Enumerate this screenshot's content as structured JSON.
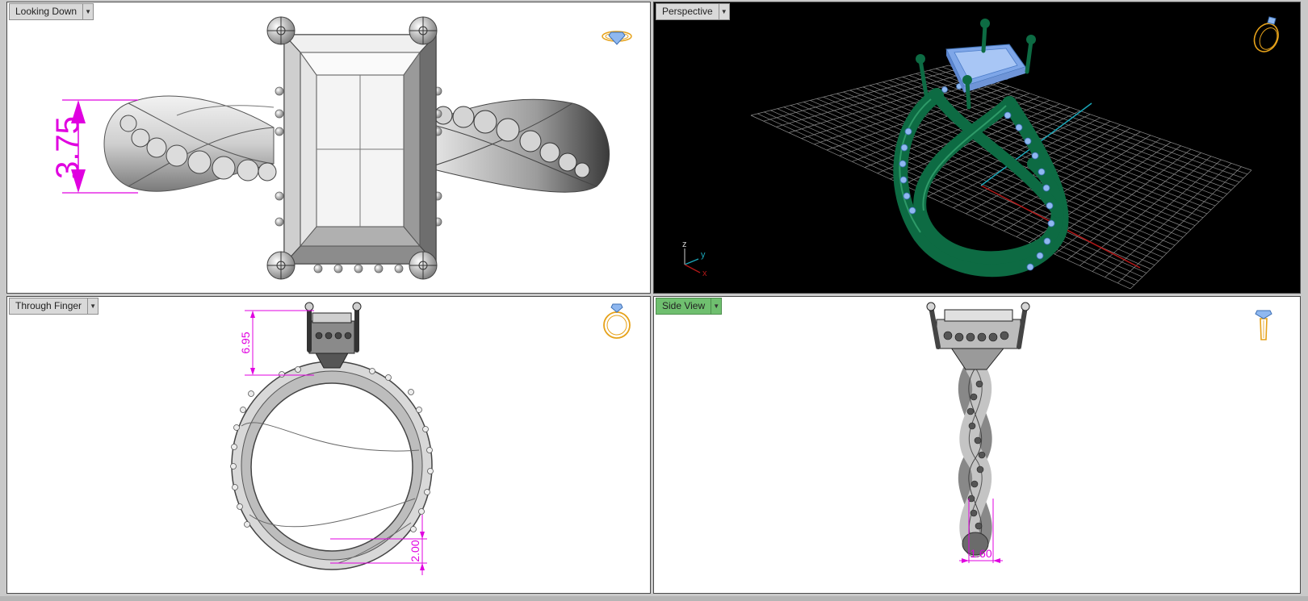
{
  "viewports": {
    "top": {
      "label": "Looking Down",
      "dimension": "3.75"
    },
    "perspective": {
      "label": "Perspective",
      "axes": {
        "x": "x",
        "y": "y",
        "z": "z"
      }
    },
    "front": {
      "label": "Through Finger",
      "dim_head": "6.95",
      "dim_shank": "2.00"
    },
    "side": {
      "label": "Side View",
      "dim_width": "1.60",
      "active": true
    }
  },
  "colors": {
    "dimension": "#e000e0",
    "ring_green": "#0d6b43",
    "stone_blue": "#8fb8f0",
    "grid": "#8a8a8a",
    "x_axis": "#b01818",
    "y_axis": "#1aa6b8",
    "active_label": "#6fbf6f",
    "orientation_icon": "#e6a21a"
  },
  "icons": {
    "top": "ring-top-icon",
    "perspective": "ring-perspective-icon",
    "front": "ring-front-icon",
    "side": "ring-side-icon"
  }
}
